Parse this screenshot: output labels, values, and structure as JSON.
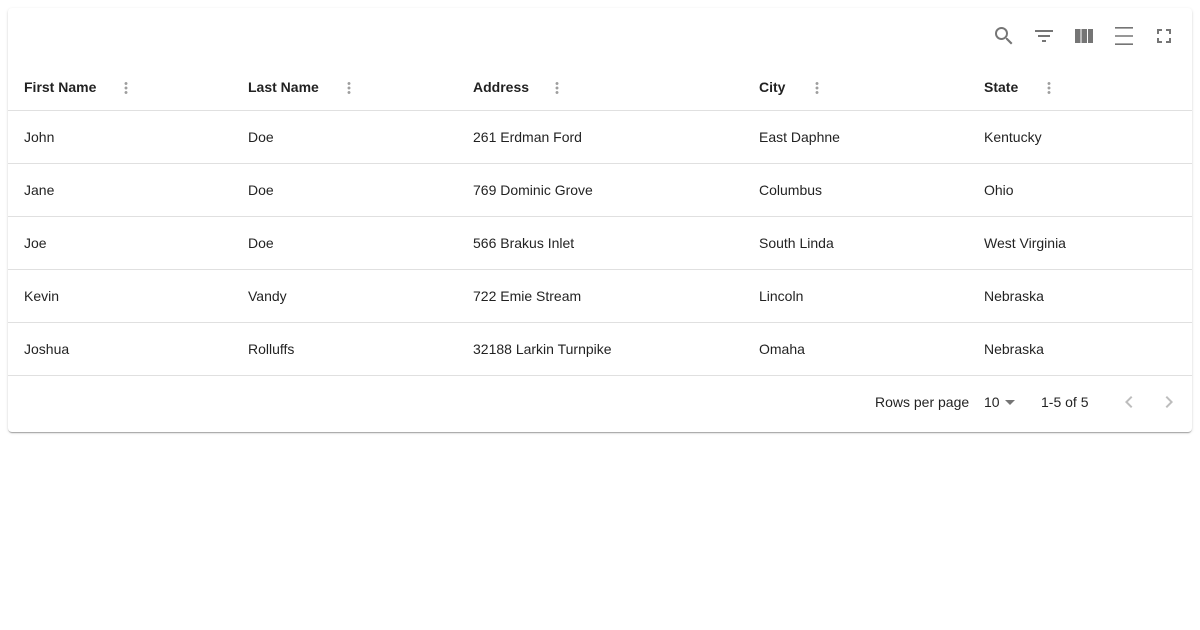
{
  "toolbar": {
    "icons": [
      "search-icon",
      "filter-icon",
      "columns-icon",
      "density-icon",
      "fullscreen-icon"
    ]
  },
  "table": {
    "columns": [
      {
        "label": "First Name"
      },
      {
        "label": "Last Name"
      },
      {
        "label": "Address"
      },
      {
        "label": "City"
      },
      {
        "label": "State"
      }
    ],
    "rows": [
      [
        "John",
        "Doe",
        "261 Erdman Ford",
        "East Daphne",
        "Kentucky"
      ],
      [
        "Jane",
        "Doe",
        "769 Dominic Grove",
        "Columbus",
        "Ohio"
      ],
      [
        "Joe",
        "Doe",
        "566 Brakus Inlet",
        "South Linda",
        "West Virginia"
      ],
      [
        "Kevin",
        "Vandy",
        "722 Emie Stream",
        "Lincoln",
        "Nebraska"
      ],
      [
        "Joshua",
        "Rolluffs",
        "32188 Larkin Turnpike",
        "Omaha",
        "Nebraska"
      ]
    ]
  },
  "pagination": {
    "rows_per_page_label": "Rows per page",
    "rows_per_page_value": "10",
    "range_label": "1-5 of 5"
  },
  "colors": {
    "icon": "#757575",
    "divider": "#e0e0e0",
    "disabled": "#bdbdbd"
  }
}
